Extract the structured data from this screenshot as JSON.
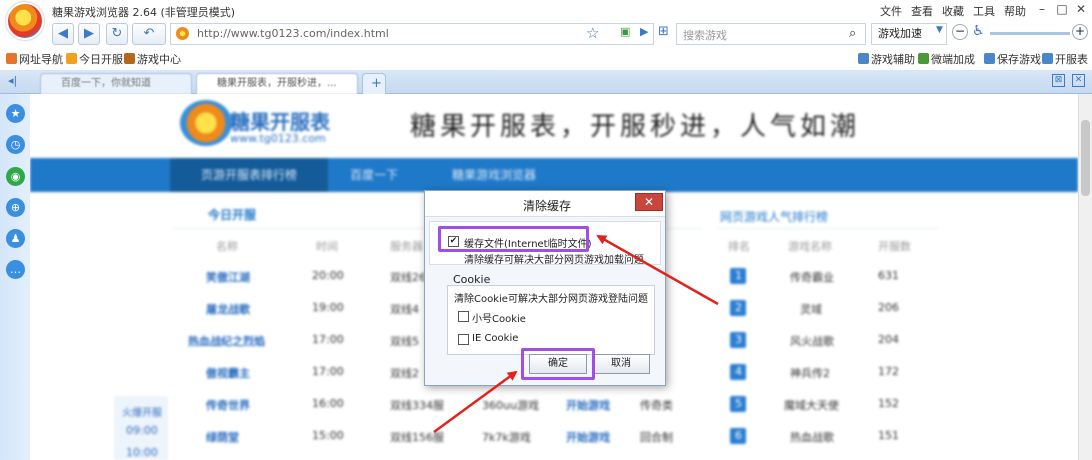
{
  "titlebar": {
    "app_title": "糖果游戏浏览器 2.64 (非管理员模式)",
    "menu": [
      "文件",
      "查看",
      "收藏",
      "工具",
      "帮助"
    ],
    "win_controls": [
      "–",
      "□",
      "✕"
    ]
  },
  "navbar": {
    "back_icon": "◀",
    "forward_icon": "▶",
    "refresh_icon": "↻",
    "undo_icon": "↶",
    "url": "http://www.tg0123.com/index.html",
    "search_placeholder": "搜索游戏",
    "accel_label": "游戏加速",
    "zoom_minus": "−",
    "zoom_plus": "+"
  },
  "bookmarks": {
    "left": [
      "网址导航",
      "今日开服",
      "游戏中心"
    ],
    "right": [
      "游戏辅助",
      "微端加成",
      "保存游戏",
      "开服表"
    ]
  },
  "tabs": [
    {
      "label": "百度一下，你就知道"
    },
    {
      "label": "糖果开服表，开服秒进，..."
    }
  ],
  "new_tab_label": "+",
  "page": {
    "site_name": "糖果开服表",
    "site_url": "www.tg0123.com",
    "slogan": "糖果开服表，开服秒进，人气如潮",
    "nav": [
      "页游开服表排行榜",
      "百度一下",
      "糖果游戏浏览器"
    ],
    "today_title": "今日开服",
    "today_headers": [
      "名称",
      "时间",
      "服务器"
    ],
    "today_rows": [
      {
        "name": "笑傲江湖",
        "time": "20:00",
        "server": "双线26"
      },
      {
        "name": "屠龙战歌",
        "time": "19:00",
        "server": "双线4"
      },
      {
        "name": "热血战纪之烈焰",
        "time": "17:00",
        "server": "双线5"
      },
      {
        "name": "傲视霸主",
        "time": "17:00",
        "server": "双线2"
      },
      {
        "name": "传奇世界",
        "time": "16:00",
        "server": "双线334服",
        "platform": "360uu游戏",
        "op": "开始游戏",
        "type": "传奇类"
      },
      {
        "name": "绿荫堂",
        "time": "15:00",
        "server": "双线156服",
        "platform": "7k7k游戏",
        "op": "开始游戏",
        "type": "回合制"
      }
    ],
    "left_strip": {
      "title": "火爆开服",
      "times": [
        "09:00",
        "10:00"
      ]
    },
    "rank_title": "网页游戏人气排行榜",
    "rank_headers": [
      "排名",
      "游戏名称",
      "开服数"
    ],
    "rank_rows": [
      {
        "rank": "1",
        "name": "传奇霸业",
        "count": "631"
      },
      {
        "rank": "2",
        "name": "灵域",
        "count": "206"
      },
      {
        "rank": "3",
        "name": "风火战歌",
        "count": "204"
      },
      {
        "rank": "4",
        "name": "神兵传2",
        "count": "172"
      },
      {
        "rank": "5",
        "name": "魔域大天使",
        "count": "152"
      },
      {
        "rank": "6",
        "name": "热血战歌",
        "count": "151"
      }
    ]
  },
  "dialog": {
    "title": "清除缓存",
    "close": "✕",
    "cache_checkbox_label": "缓存文件(Internet临时文件)",
    "cache_checked": true,
    "cache_desc": "清除缓存可解决大部分网页游戏加载问题",
    "cookie_group": "Cookie",
    "cookie_desc": "清除Cookie可解决大部分网页游戏登陆问题",
    "small_cookie": "小号Cookie",
    "ie_cookie": "IE Cookie",
    "ok": "确定",
    "cancel": "取消"
  },
  "colors": {
    "accent": "#1f79c9",
    "highlight": "#a04ee6",
    "arrow": "#e0231e"
  }
}
